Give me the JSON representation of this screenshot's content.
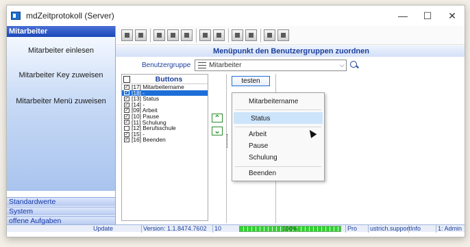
{
  "window": {
    "title": "mdZeitprotokoll (Server)",
    "min": "—",
    "max": "☐",
    "close": "✕"
  },
  "left": {
    "header": "Mitarbeiter",
    "items": [
      "Mitarbeiter einlesen",
      "Mitarbeiter Key zuweisen",
      "Mitarbeiter Menü zuweisen"
    ],
    "footer": [
      "Standardwerte",
      "System",
      "offene Aufgaben"
    ]
  },
  "toolbar": {
    "icons": [
      "grid-icon",
      "list-icon",
      "save-icon",
      "image-icon",
      "preview-icon",
      "table-icon",
      "stack-icon",
      "mail-icon",
      "report-icon",
      "tools-icon",
      "palette-icon"
    ]
  },
  "main": {
    "title": "Menüpunkt den Benutzergruppen zuordnen",
    "filter_label": "Benutzergruppe",
    "filter_value": "Mitarbeiter",
    "buttons_title": "Buttons",
    "buttons": [
      {
        "label": "[17] Mitarbeitername",
        "checked": true,
        "selected": false
      },
      {
        "label": "[18] -",
        "checked": true,
        "selected": true
      },
      {
        "label": "[13] Status",
        "checked": true,
        "selected": false
      },
      {
        "label": "[14] -",
        "checked": true,
        "selected": false
      },
      {
        "label": "[09] Arbeit",
        "checked": true,
        "selected": false
      },
      {
        "label": "[10] Pause",
        "checked": true,
        "selected": false
      },
      {
        "label": "[11] Schulung",
        "checked": true,
        "selected": false
      },
      {
        "label": "[12] Berufsschule",
        "checked": false,
        "selected": false
      },
      {
        "label": "[15] -",
        "checked": true,
        "selected": false
      },
      {
        "label": "[16] Beenden",
        "checked": true,
        "selected": false
      }
    ],
    "testen_label": "testen",
    "popup": {
      "item1": "Mitarbeitername",
      "item2": "Status",
      "item3": "Arbeit",
      "item4": "Pause",
      "item5": "Schulung",
      "item6": "Beenden"
    }
  },
  "status": {
    "update": "Update",
    "version": "Version: 1.1.8474.7602",
    "num": "10",
    "progress": "100%",
    "progress_value": 100,
    "edition": "Pro",
    "support": "ustrich.support",
    "info": "Info",
    "user": "1: Admin"
  },
  "colors": {
    "accent": "#1a47b8",
    "selected": "#1e6ed8",
    "progress": "#33d233"
  }
}
